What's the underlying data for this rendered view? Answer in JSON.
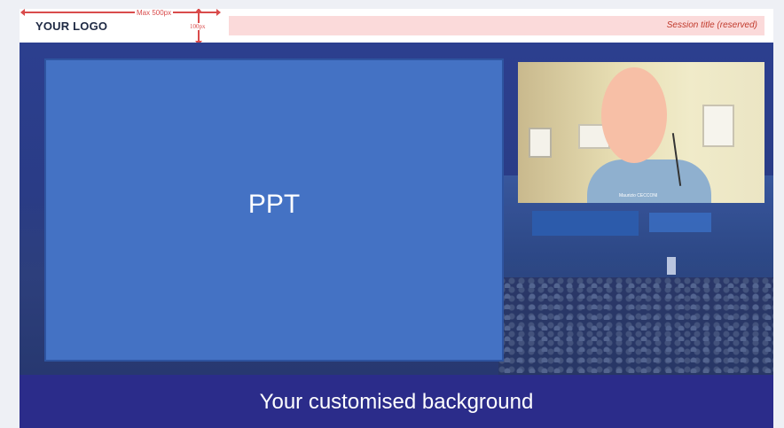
{
  "header": {
    "logo_text": "YOUR LOGO",
    "width_note": "Max 500px",
    "height_note": "100px",
    "session_title": "Session title (reserved)"
  },
  "stage": {
    "ppt_label": "PPT",
    "camera_name": "Maurizio CECCONI"
  },
  "footer": {
    "background_label": "Your customised background"
  },
  "colors": {
    "header_bg": "#ffffff",
    "annotation_red": "#d94b4b",
    "session_bar": "#fbdada",
    "stage_bg": "#2c3f8f",
    "ppt_fill": "#4472c4",
    "footer_bg": "#2b2c8a"
  }
}
